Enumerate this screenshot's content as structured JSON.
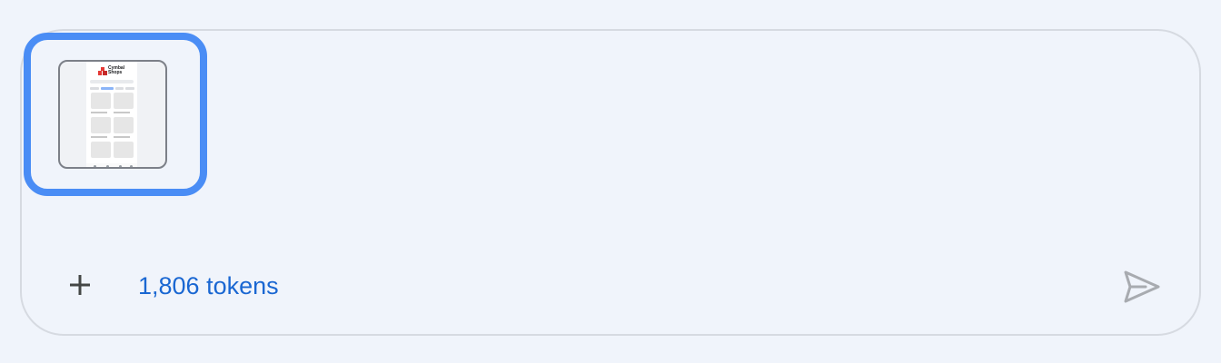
{
  "composer": {
    "token_count_label": "1,806 tokens",
    "add_icon": "plus-icon",
    "send_icon": "send-icon",
    "focus_color": "#4a8df5",
    "token_color": "#1a67d2"
  },
  "attachment": {
    "kind": "image",
    "preview_brand": "Cymbal Shops"
  }
}
